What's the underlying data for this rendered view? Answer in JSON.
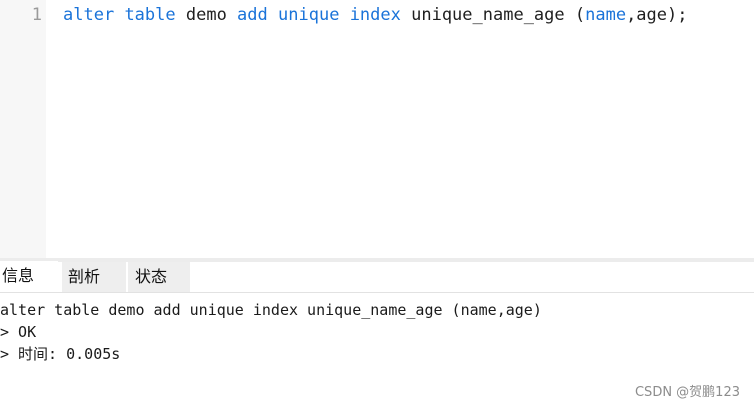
{
  "editor": {
    "line_number": "1",
    "tokens": [
      {
        "text": "alter",
        "kind": "keyword"
      },
      {
        "text": " ",
        "kind": "plain"
      },
      {
        "text": "table",
        "kind": "keyword"
      },
      {
        "text": " demo ",
        "kind": "plain"
      },
      {
        "text": "add",
        "kind": "keyword"
      },
      {
        "text": " ",
        "kind": "plain"
      },
      {
        "text": "unique",
        "kind": "keyword"
      },
      {
        "text": " ",
        "kind": "plain"
      },
      {
        "text": "index",
        "kind": "keyword"
      },
      {
        "text": " unique_name_age (",
        "kind": "plain"
      },
      {
        "text": "name",
        "kind": "keyword"
      },
      {
        "text": ",age);",
        "kind": "plain"
      }
    ],
    "keyword_color": "#1a73d9",
    "text_color": "#1f1f1f"
  },
  "tabs": {
    "info": "信息",
    "profile": "剖析",
    "status": "状态"
  },
  "messages": {
    "query": "alter table demo add unique index unique_name_age (name,age)",
    "result": "> OK",
    "time": "> 时间: 0.005s"
  },
  "watermark": "CSDN @贺鹏123"
}
